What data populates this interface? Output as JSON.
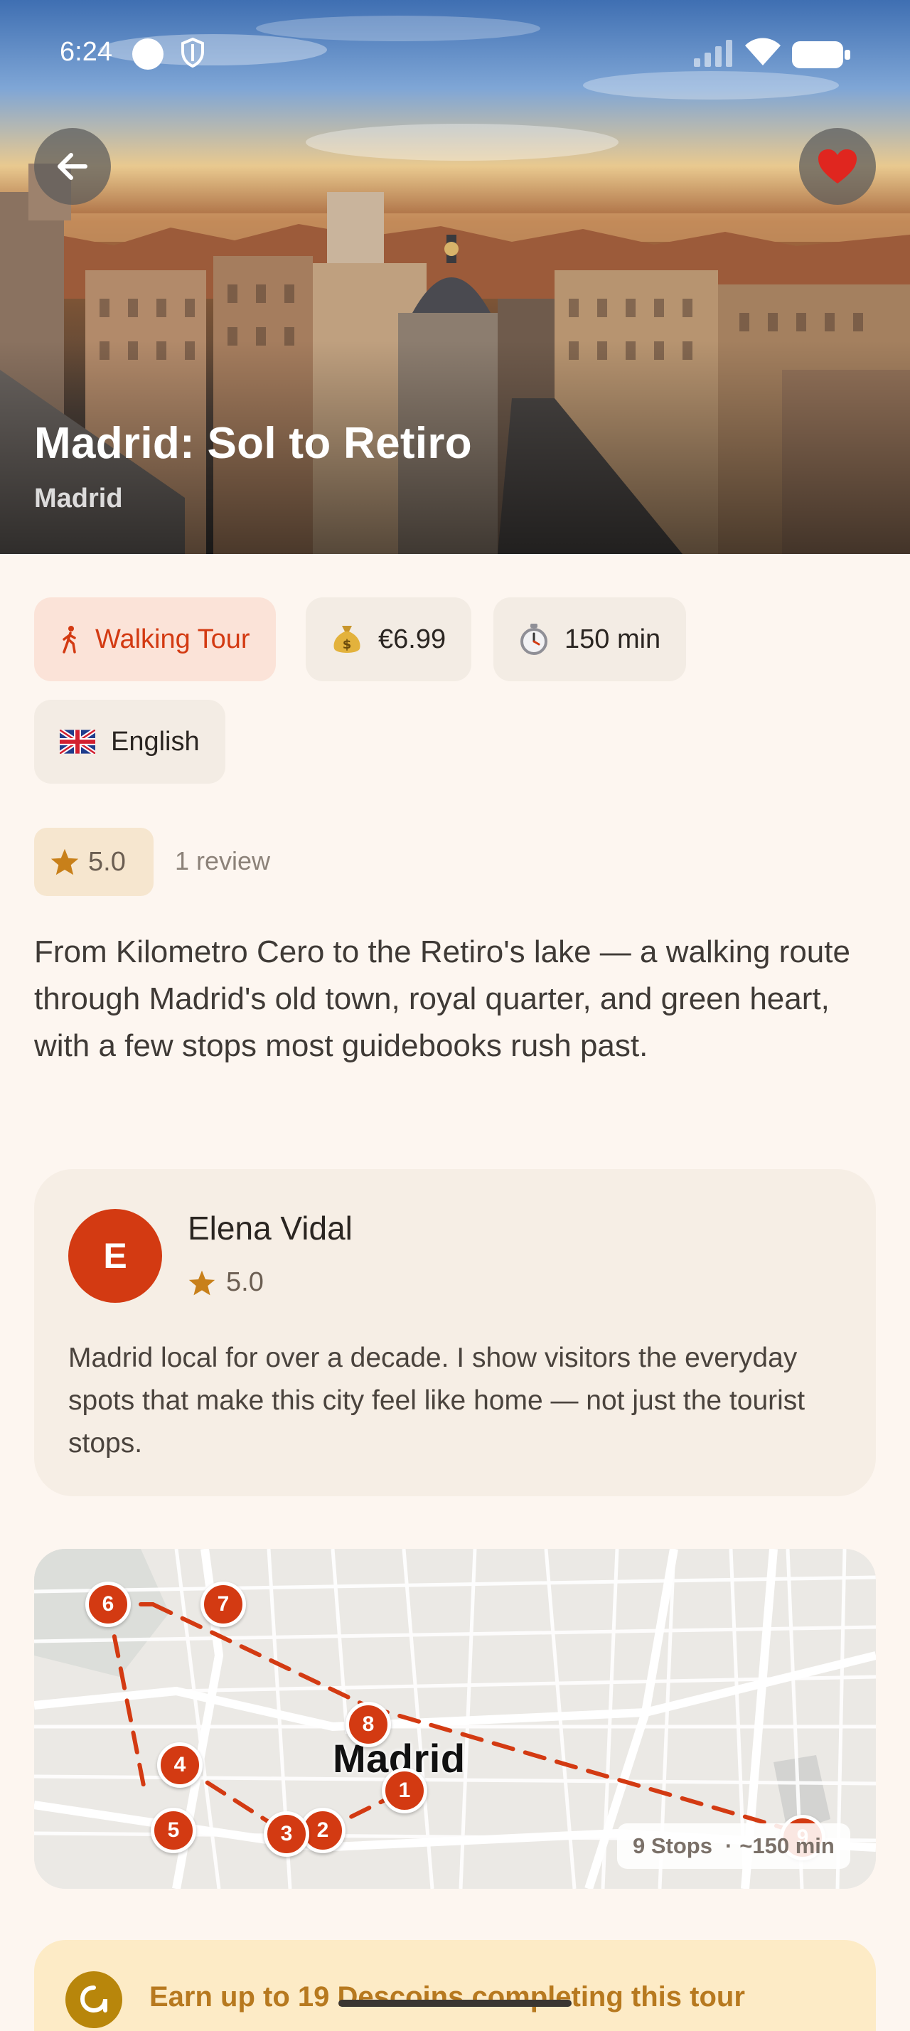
{
  "status_bar": {
    "time": "6:24"
  },
  "hero": {
    "title": "Madrid: Sol to Retiro",
    "city": "Madrid"
  },
  "chips": {
    "tour_type": "Walking Tour",
    "price": "€6.99",
    "duration": "150 min",
    "language": "English"
  },
  "rating": {
    "score": "5.0",
    "reviews": "1 review"
  },
  "description": "From Kilometro Cero to the Retiro's lake — a walking route through Madrid's old town, royal quarter, and green heart, with a few stops most guidebooks rush past.",
  "guide": {
    "initial": "E",
    "name": "Elena Vidal",
    "rating": "5.0",
    "bio": "Madrid local for over a decade. I show visitors the everyday spots that make this city feel like home — not just the tourist stops."
  },
  "map": {
    "city_label": "Madrid",
    "stops_label": "9 Stops",
    "duration_label": "~150 min",
    "markers": [
      "1",
      "2",
      "3",
      "4",
      "5",
      "6",
      "7",
      "8",
      "9"
    ]
  },
  "rewards": {
    "text": "Earn up to 19 Descoins completing this tour"
  },
  "colors": {
    "accent": "#D33A12",
    "background": "#FDF6F0",
    "star": "#C8801A",
    "reward_text": "#B7791F"
  },
  "icons": [
    "back-arrow-icon",
    "heart-icon",
    "walking-icon",
    "money-bag-icon",
    "stopwatch-icon",
    "uk-flag-icon",
    "star-icon",
    "coin-icon"
  ]
}
